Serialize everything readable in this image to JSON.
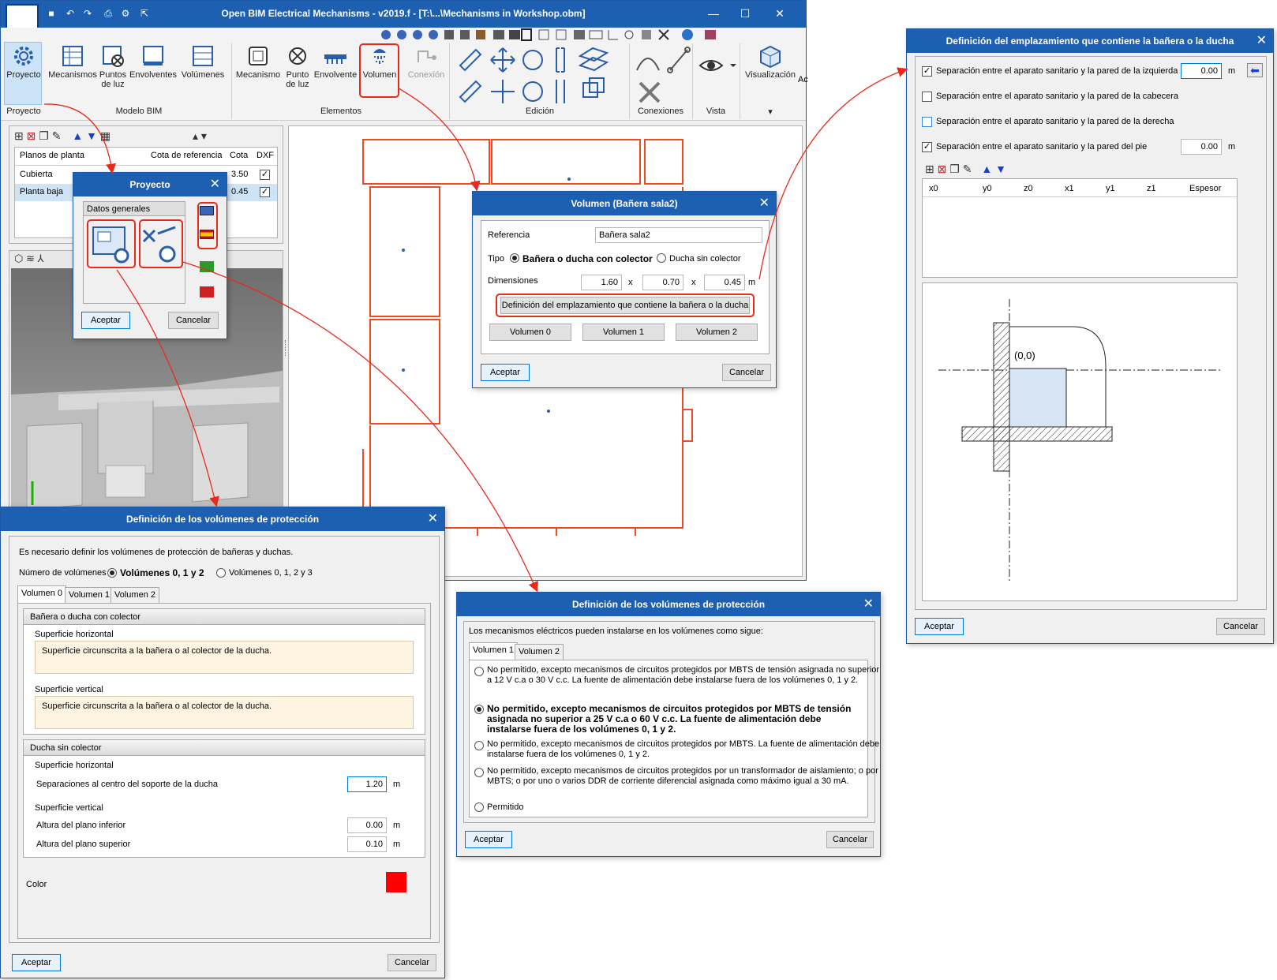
{
  "app": {
    "title": "Open BIM Electrical Mechanisms - v2019.f - [T:\\...\\Mechanisms in Workshop.obm]"
  },
  "ribbon": {
    "buttons": {
      "proyecto": "Proyecto",
      "mecanismos": "Mecanismos",
      "puntos_de_luz": "Puntos de luz",
      "envolventes": "Envolventes",
      "volumenes": "Volúmenes",
      "mecanismo": "Mecanismo",
      "punto_de_luz": "Punto de luz",
      "envolvente": "Envolvente",
      "volumen": "Volumen",
      "conexion": "Conexión",
      "visualizacion": "Visualización",
      "ac": "Ac"
    },
    "groups": {
      "proyecto": "Proyecto",
      "modelo_bim": "Modelo BIM",
      "elementos": "Elementos",
      "edicion": "Edición",
      "conexiones": "Conexiones",
      "vista": "Vista"
    }
  },
  "floors_table": {
    "headers": [
      "Planos de planta",
      "Cota de referencia",
      "Cota",
      "DXF"
    ],
    "rows": [
      {
        "name": "Cubierta",
        "ref": "",
        "cota": "3.50",
        "dxf": true
      },
      {
        "name": "Planta baja",
        "ref": "",
        "cota": "0.45",
        "dxf": true
      }
    ]
  },
  "proyecto_dialog": {
    "title": "Proyecto",
    "group": "Datos generales",
    "ok": "Aceptar",
    "cancel": "Cancelar"
  },
  "volumen_dialog": {
    "title": "Volumen (Bañera sala2)",
    "referencia_label": "Referencia",
    "referencia_value": "Bañera sala2",
    "tipo_label": "Tipo",
    "tipo_opt1": "Bañera o ducha con colector",
    "tipo_opt2": "Ducha sin colector",
    "dimensiones_label": "Dimensiones",
    "dim1": "1.60",
    "dim2": "0.70",
    "dim3": "0.45",
    "x_sep": "x",
    "unit": "m",
    "def_button": "Definición del emplazamiento que contiene la bañera o la ducha",
    "vol0": "Volumen 0",
    "vol1": "Volumen 1",
    "vol2": "Volumen 2",
    "ok": "Aceptar",
    "cancel": "Cancelar"
  },
  "emplazamiento_dialog": {
    "title": "Definición del emplazamiento que contiene la bañera o la ducha",
    "checks": [
      {
        "label": "Separación entre el aparato sanitario y la pared de la izquierda",
        "checked": true,
        "value": "0.00",
        "unit": "m"
      },
      {
        "label": "Separación entre el aparato sanitario y la pared de la cabecera",
        "checked": false,
        "value": "",
        "unit": ""
      },
      {
        "label": "Separación entre el aparato sanitario y la pared de la derecha",
        "checked": false,
        "value": "",
        "unit": ""
      },
      {
        "label": "Separación entre el aparato sanitario y la pared del pie",
        "checked": true,
        "value": "0.00",
        "unit": "m"
      }
    ],
    "table_headers": [
      "x0",
      "y0",
      "z0",
      "x1",
      "y1",
      "z1",
      "Espesor"
    ],
    "origin_label": "(0,0)",
    "ok": "Aceptar",
    "cancel": "Cancelar"
  },
  "vol_prot_dialog_left": {
    "title": "Definición de los volúmenes de protección",
    "intro": "Es necesario definir los volúmenes de protección de bañeras y duchas.",
    "num_label": "Número de volúmenes",
    "opt1": "Volúmenes 0, 1 y 2",
    "opt2": "Volúmenes 0, 1, 2 y 3",
    "tabs": [
      "Volumen 0",
      "Volumen 1",
      "Volumen 2"
    ],
    "sect1_title": "Bañera o ducha con colector",
    "sup_h": "Superficie horizontal",
    "sup_v": "Superficie vertical",
    "note": "Superficie circunscrita a la bañera o al colector de la ducha.",
    "sect2_title": "Ducha sin colector",
    "sep_label": "Separaciones al centro del soporte de la ducha",
    "sep_value": "1.20",
    "alt_inf_label": "Altura del plano inferior",
    "alt_inf_value": "0.00",
    "alt_sup_label": "Altura del plano superior",
    "alt_sup_value": "0.10",
    "unit": "m",
    "color_label": "Color",
    "color_value": "#ff0000",
    "ok": "Aceptar",
    "cancel": "Cancelar"
  },
  "vol_prot_dialog_right": {
    "title": "Definición de los volúmenes de protección",
    "intro": "Los mecanismos eléctricos pueden instalarse en los volúmenes como sigue:",
    "tabs": [
      "Volumen 1",
      "Volumen 2"
    ],
    "options": [
      {
        "line1": "No permitido, excepto mecanismos de circuitos protegidos por MBTS de tensión asignada no superior",
        "line2": "a 12 V c.a o 30 V c.c. La fuente de alimentación debe instalarse fuera de los volúmenes 0, 1 y 2.",
        "line3": "",
        "selected": false
      },
      {
        "line1": "No permitido, excepto mecanismos de circuitos protegidos por MBTS de tensión",
        "line2": "asignada no superior a 25 V c.a o 60 V c.c. La fuente de alimentación debe",
        "line3": "instalarse fuera de los volúmenes 0, 1 y 2.",
        "selected": true
      },
      {
        "line1": "No permitido, excepto mecanismos de circuitos protegidos por MBTS. La fuente de alimentación debe",
        "line2": "instalarse fuera de los volúmenes 0, 1 y 2.",
        "line3": "",
        "selected": false
      },
      {
        "line1": "No permitido, excepto mecanismos de circuitos protegidos por un transformador de aislamiento; o por",
        "line2": "MBTS; o por uno o varios DDR de corriente diferencial asignada como máximo igual a 30 mA.",
        "line3": "",
        "selected": false
      },
      {
        "line1": "Permitido",
        "line2": "",
        "line3": "",
        "selected": false
      }
    ],
    "ok": "Aceptar",
    "cancel": "Cancelar"
  },
  "colors": {
    "accent": "#1d5fb1",
    "highlight": "#e82a1c",
    "plan_lines": "#f04a24"
  }
}
